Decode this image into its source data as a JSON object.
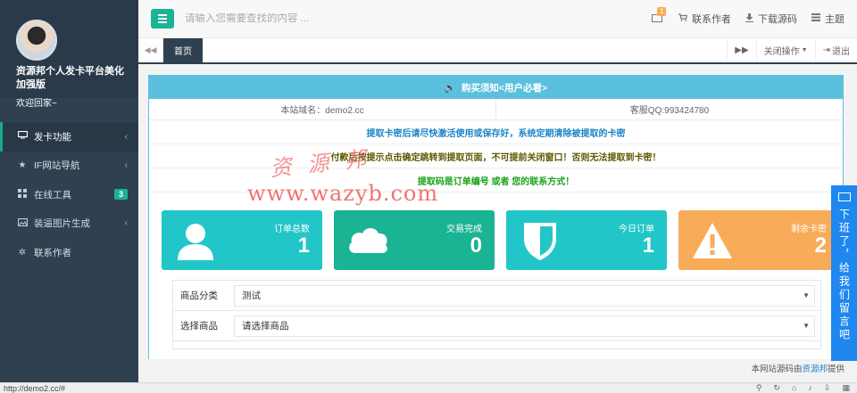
{
  "sidebar": {
    "profile_name": "资源邦个人发卡平台美化加强版",
    "welcome": "欢迎回家~",
    "items": [
      {
        "label": "发卡功能",
        "icon": "monitor-icon",
        "arrow": "‹",
        "badge": ""
      },
      {
        "label": "IF网站导航",
        "icon": "star-icon",
        "arrow": "‹",
        "badge": ""
      },
      {
        "label": "在线工具",
        "icon": "grid-icon",
        "arrow": "",
        "badge": "3"
      },
      {
        "label": "装逼图片生成",
        "icon": "image-icon",
        "arrow": "‹",
        "badge": ""
      },
      {
        "label": "联系作者",
        "icon": "gear-icon",
        "arrow": "",
        "badge": ""
      }
    ]
  },
  "topbar": {
    "search_placeholder": "请输入您需要查找的内容 ...",
    "mail_count": "1",
    "contact": "联系作者",
    "download": "下载源码",
    "theme": "主题"
  },
  "tabs": {
    "home": "首页",
    "close_ops": "关闭操作",
    "logout": "退出"
  },
  "panel": {
    "title": "购买须知<用户必看>",
    "domain": "本站域名：demo2.cc",
    "qq": "客服QQ:993424780",
    "notice1": "提取卡密后请尽快激活使用或保存好，系统定期清除被提取的卡密",
    "notice2": "付款后按提示点击确定跳转到提取页面，不可提前关闭窗口！否则无法提取到卡密！",
    "notice3": "提取码是订单编号 或者 您的联系方式！"
  },
  "watermark": {
    "line1": "资源邦",
    "line2": "www.wazyb.com"
  },
  "stats": [
    {
      "label": "订单总数",
      "value": "1",
      "color": "#23c6c8",
      "icon": "user-icon"
    },
    {
      "label": "交易完成",
      "value": "0",
      "color": "#1ab394",
      "icon": "cloud-icon"
    },
    {
      "label": "今日订单",
      "value": "1",
      "color": "#23c6c8",
      "icon": "shield-icon"
    },
    {
      "label": "剩余卡密",
      "value": "2",
      "color": "#f8ac59",
      "icon": "warning-icon"
    }
  ],
  "form": {
    "category_label": "商品分类",
    "category_value": "测试",
    "product_label": "选择商品",
    "product_value": "请选择商品"
  },
  "float_contact": {
    "text": "下班了，给我们留言吧"
  },
  "footer": {
    "prefix": "本网站源码由",
    "link": "资源邦",
    "suffix": "提供"
  },
  "statusbar": {
    "url": "http://demo2.cc/#"
  }
}
